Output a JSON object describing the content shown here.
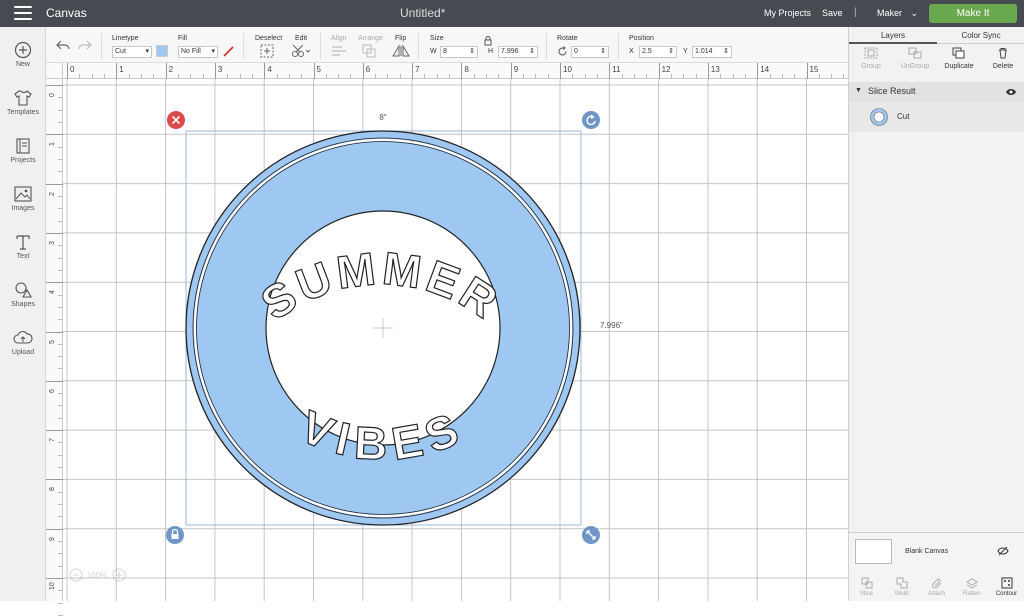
{
  "topbar": {
    "app_title": "Canvas",
    "doc_title": "Untitled*",
    "my_projects": "My Projects",
    "save": "Save",
    "separator": "|",
    "machine": "Maker",
    "machine_chevron": "⌄",
    "make_it": "Make It"
  },
  "leftnav": [
    {
      "label": "New",
      "icon": "plus-circle-icon"
    },
    {
      "label": "Templates",
      "icon": "tshirt-icon"
    },
    {
      "label": "Projects",
      "icon": "notebook-icon"
    },
    {
      "label": "Images",
      "icon": "image-icon"
    },
    {
      "label": "Text",
      "icon": "text-icon"
    },
    {
      "label": "Shapes",
      "icon": "shapes-icon"
    },
    {
      "label": "Upload",
      "icon": "cloud-upload-icon"
    }
  ],
  "toolbar": {
    "linetype_label": "Linetype",
    "linetype_value": "Cut",
    "fill_label": "Fill",
    "fill_value": "No Fill",
    "deselect_label": "Deselect",
    "edit_label": "Edit",
    "align_label": "Align",
    "arrange_label": "Arrange",
    "flip_label": "Flip",
    "size_label": "Size",
    "w_label": "W",
    "w_value": "8",
    "h_label": "H",
    "h_value": "7.996",
    "rotate_label": "Rotate",
    "rotate_value": "0",
    "position_label": "Position",
    "x_label": "X",
    "x_value": "2.5",
    "y_label": "Y",
    "y_value": "1.014",
    "swatch_color": "#9ec8f2"
  },
  "ruler": {
    "top": [
      "0",
      "1",
      "2",
      "3",
      "4",
      "5",
      "6",
      "7",
      "8",
      "9",
      "10",
      "11",
      "12",
      "13",
      "14",
      "15"
    ],
    "left": [
      "0",
      "1",
      "2",
      "3",
      "4",
      "5",
      "6",
      "7",
      "8",
      "9",
      "10"
    ]
  },
  "canvas": {
    "width_label": "8\"",
    "height_label": "7.996\"",
    "top_text": "SUMMER",
    "bottom_text": "VIBES",
    "fill_color": "#9ec8f2",
    "zoom": "100%"
  },
  "layers_panel": {
    "tab_layers": "Layers",
    "tab_colorsync": "Color Sync",
    "actions": [
      "Group",
      "UnGroup",
      "Duplicate",
      "Delete"
    ],
    "group_title": "Slice Result",
    "layer_name": "Cut",
    "blank_canvas": "Blank Canvas",
    "bottom_actions": [
      "Slice",
      "Weld",
      "Attach",
      "Flatten",
      "Contour"
    ]
  }
}
